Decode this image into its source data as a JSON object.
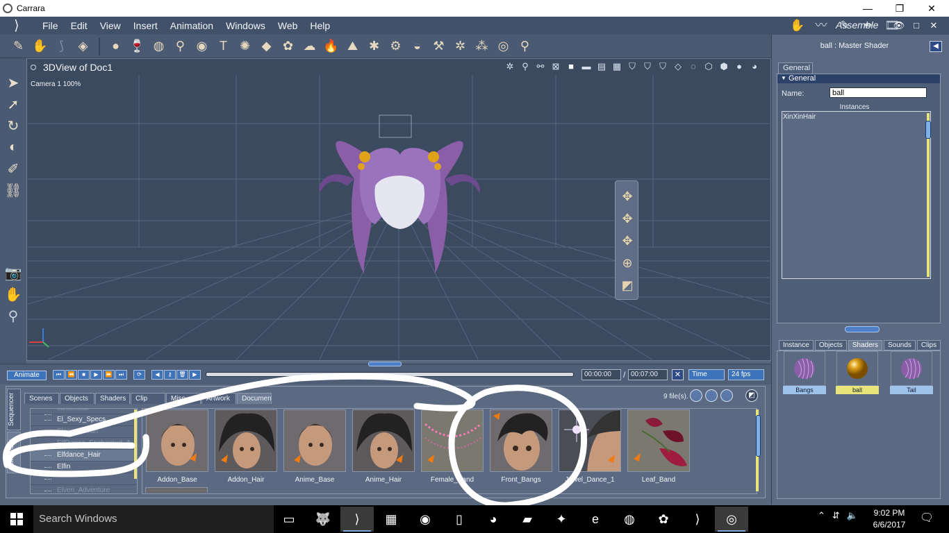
{
  "window": {
    "title": "Carrara",
    "minimize": "—",
    "restore": "❐",
    "close": "✕"
  },
  "menu": {
    "items": [
      "File",
      "Edit",
      "View",
      "Insert",
      "Animation",
      "Windows",
      "Web",
      "Help"
    ],
    "room": "Assemble"
  },
  "viewport": {
    "title": "3DView of Doc1",
    "camera": "Camera 1 100%"
  },
  "properties": {
    "header": "ball : Master Shader",
    "tab": "General",
    "section": "General",
    "name_label": "Name:",
    "name_value": "ball",
    "instances_label": "Instances",
    "instances": [
      "XinXinHair"
    ]
  },
  "library": {
    "tabs": [
      "Instance",
      "Objects",
      "Shaders",
      "Sounds",
      "Clips"
    ],
    "selected_tab": "Shaders",
    "swatches": [
      {
        "label": "Bangs",
        "color": "#8b5fa8"
      },
      {
        "label": "ball",
        "color": "#e0a21a"
      },
      {
        "label": "Tail",
        "color": "#8b5fa8"
      }
    ]
  },
  "animation": {
    "animate_label": "Animate",
    "current_time": "00:00:00",
    "separator": "/",
    "end_time": "00:07:00",
    "time_mode": "Time",
    "fps": "24 fps"
  },
  "browser": {
    "side_tabs": [
      "Sequencer",
      "Browser"
    ],
    "tabs": [
      "Scenes",
      "Objects",
      "Shaders",
      "Clip",
      "Misc.",
      "Artwork",
      "Document"
    ],
    "file_count": "9 file(s).",
    "folders": [
      "easterstall",
      "El_Sexy_Specs",
      "ElegantSwan",
      "ElfDance_Enchanted_A",
      "Elfdance_Hair",
      "Elfin",
      "",
      "Elven_Adventure"
    ],
    "selected_folder": "Elfdance_Hair",
    "thumbnails": [
      "Addon_Base",
      "Addon_Hair",
      "Anime_Base",
      "Anime_Hair",
      "Female_Band",
      "Front_Bangs",
      "Jewel_Dance_1",
      "Leaf_Band"
    ]
  },
  "taskbar": {
    "search_placeholder": "Search Windows",
    "time": "9:02 PM",
    "date": "6/6/2017"
  },
  "colors": {
    "accent": "#3c73b9",
    "panel": "#5b6a82",
    "viewport_bg": "#3c4a60",
    "hair_purple": "#8b5fa8",
    "annotation": "#ffffff"
  }
}
